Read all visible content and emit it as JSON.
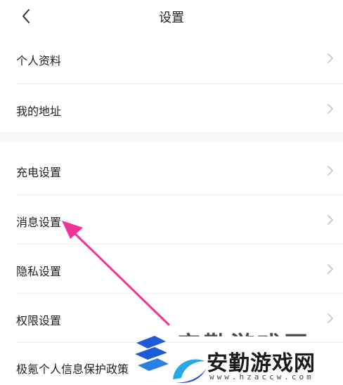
{
  "header": {
    "title": "设置",
    "back_icon": "chevron-left-icon"
  },
  "groups": [
    {
      "items": [
        {
          "label": "个人资料"
        },
        {
          "label": "我的地址"
        }
      ]
    },
    {
      "items": [
        {
          "label": "充电设置"
        },
        {
          "label": "消息设置"
        },
        {
          "label": "隐私设置"
        },
        {
          "label": "权限设置"
        },
        {
          "label": "极氪个人信息保护政策"
        }
      ]
    }
  ],
  "row_icon": "chevron-right-icon",
  "annotation": {
    "arrow_color": "#f0339a",
    "points_to": "消息设置"
  },
  "watermark": {
    "text_cn": "安勤游戏网",
    "text_bg": "安勤游戏网",
    "url": "www.hzaccw.com",
    "logo_colors": [
      "#1e5bd8",
      "#2aa7e8"
    ]
  }
}
